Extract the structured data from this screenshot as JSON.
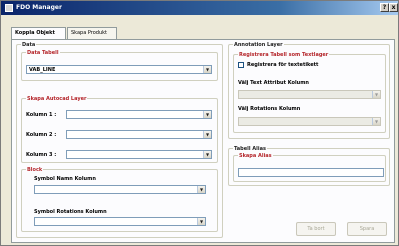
{
  "window": {
    "title": "FDO Manager",
    "help_label": "?",
    "close_label": "x"
  },
  "tabs": [
    {
      "label": "Koppla Objekt"
    },
    {
      "label": "Skapa Produkt"
    }
  ],
  "data_group": {
    "title": "Data",
    "data_tabell": {
      "title": "Data Tabell",
      "value": "VAB_LINE"
    },
    "skapa_autocad_layer": {
      "title": "Skapa Autocad Layer",
      "kolumn1_label": "Kolumn 1 :",
      "kolumn2_label": "Kolumn 2 :",
      "kolumn3_label": "Kolumn 3 :"
    },
    "block": {
      "title": "Block",
      "symbol_namn_label": "Symbol Namn Kolumn",
      "symbol_rotation_label": "Symbol Rotations Kolumn"
    }
  },
  "annotation_group": {
    "title": "Annotation Layer",
    "registrera_title": "Registrera Tabell som Textlager",
    "checkbox_label": "Registrera för textetikett",
    "attribut_label": "Välj Text Attribut Kolumn",
    "rotations_label": "Välj Rotations Kolumn"
  },
  "alias_group": {
    "title": "Tabell Alias",
    "skapa_alias_title": "Skapa Alias"
  },
  "buttons": {
    "tabort": "Ta bort",
    "spara": "Spara"
  }
}
